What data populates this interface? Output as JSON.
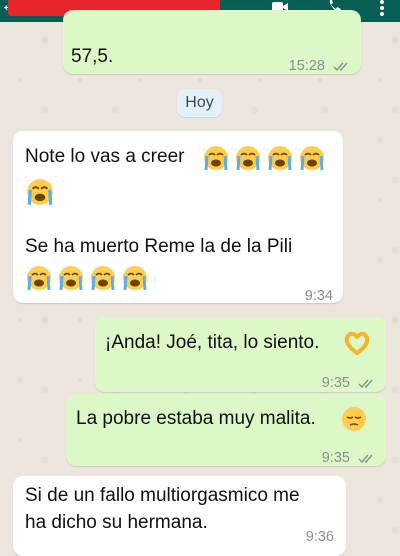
{
  "header": {
    "back_glyph": "←",
    "icons": [
      "video-call-icon",
      "voice-call-icon",
      "more-menu-icon"
    ]
  },
  "messages": [
    {
      "direction": "out",
      "lines": [
        "57,5."
      ],
      "time": "15:28",
      "status": "read"
    },
    {
      "direction": "in",
      "lines": [
        "Note lo vas a creer",
        "Se ha muerto Reme la de la Pili"
      ],
      "emojis": [
        "loudly-crying-face x5",
        "loudly-crying-face x4"
      ],
      "time": "9:34"
    },
    {
      "direction": "out",
      "lines": [
        "¡Anda! Joé, tita, lo siento."
      ],
      "emojis": [
        "heart-hands"
      ],
      "time": "9:35",
      "status": "read"
    },
    {
      "direction": "out",
      "lines": [
        "La pobre estaba muy malita."
      ],
      "emojis": [
        "pensive-face"
      ],
      "time": "9:35",
      "status": "read"
    },
    {
      "direction": "in",
      "lines": [
        "Si de un fallo multiorgasmico me",
        "ha dicho su hermana."
      ],
      "time": "9:36"
    }
  ],
  "day_separator": "Hoy",
  "colors": {
    "header": "#075e54",
    "incoming": "#ffffff",
    "outgoing": "#dcf8c6",
    "chat_bg": "#ece5dd",
    "read_ticks": "#8a8f8c"
  }
}
